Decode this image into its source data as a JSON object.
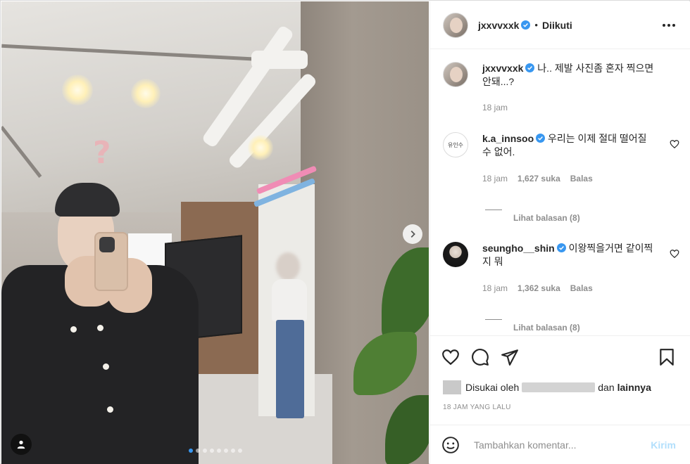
{
  "header": {
    "username": "jxxvvxxk",
    "separator": "•",
    "follow_status": "Diikuti"
  },
  "caption": {
    "username": "jxxvvxxk",
    "text": "나.. 제발 사진좀 혼자 찍으면 안돼...?",
    "time": "18 jam"
  },
  "comments": [
    {
      "username": "k.a_innsoo",
      "avatar_text": "유인수",
      "text": "우리는 이제 절대 떨어질 수 없어.",
      "time": "18 jam",
      "likes": "1,627 suka",
      "reply": "Balas",
      "view_replies": "Lihat balasan (8)"
    },
    {
      "username": "seungho__shin",
      "text": "이왕찍을거면 같이찍지 뭐",
      "time": "18 jam",
      "likes": "1,362 suka",
      "reply": "Balas",
      "view_replies": "Lihat balasan (8)"
    }
  ],
  "likes": {
    "prefix": "Disukai oleh",
    "connector": "dan",
    "others": "lainnya"
  },
  "timestamp": "18 JAM YANG LALU",
  "add_comment": {
    "placeholder": "Tambahkan komentar...",
    "send_label": "Kirim"
  },
  "photo": {
    "overlay_text": "?",
    "carousel_count": 8,
    "carousel_active": 0
  },
  "colors": {
    "verified": "#3897f0",
    "send_disabled": "#b2dffc",
    "muted": "#8e8e8e",
    "text": "#262626"
  },
  "icons": [
    "more-icon",
    "verified-icon",
    "heart-icon",
    "comment-icon",
    "share-icon",
    "bookmark-icon",
    "emoji-icon",
    "next-arrow-icon",
    "user-tag-icon"
  ]
}
